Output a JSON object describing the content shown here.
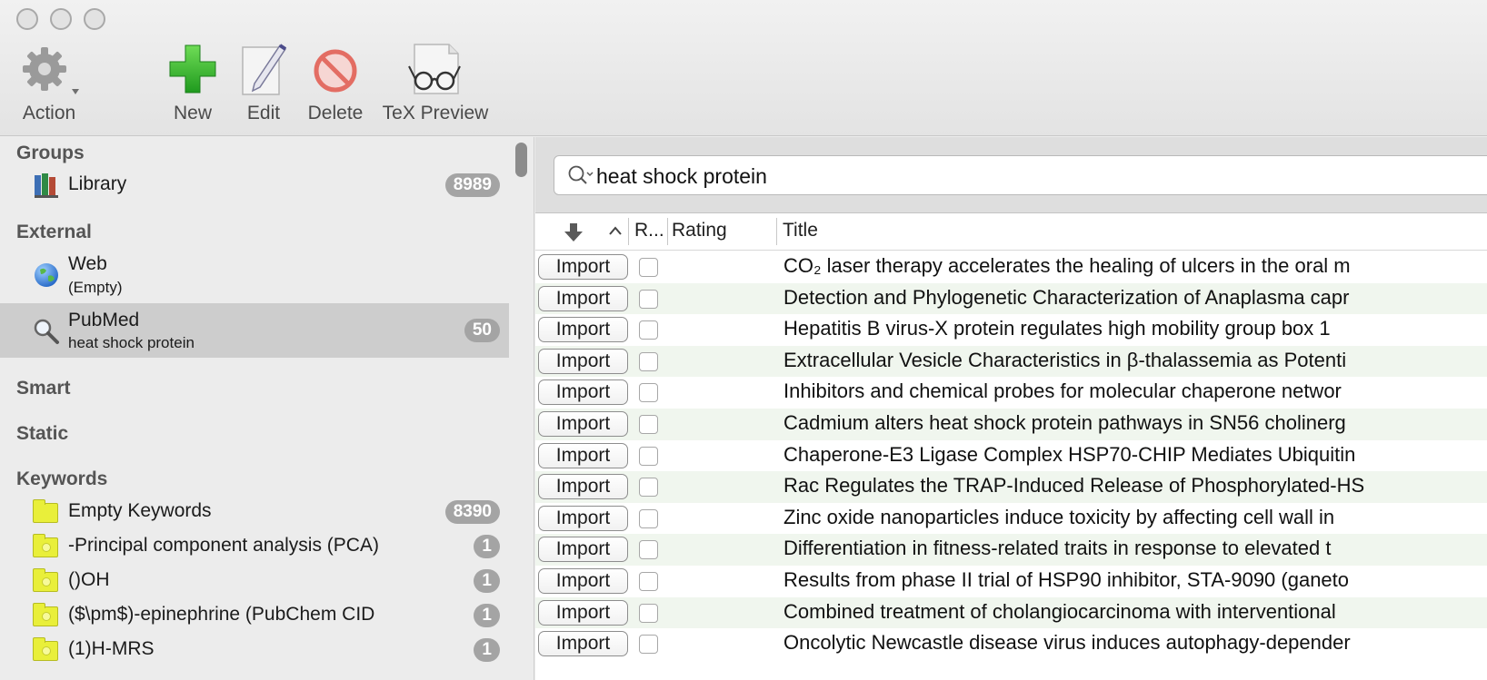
{
  "toolbar": {
    "action_label": "Action",
    "new_label": "New",
    "edit_label": "Edit",
    "delete_label": "Delete",
    "tex_preview_label": "TeX Preview"
  },
  "sidebar": {
    "groups_header": "Groups",
    "library": {
      "label": "Library",
      "count": "8989"
    },
    "external_header": "External",
    "web": {
      "label": "Web",
      "sub": "(Empty)"
    },
    "pubmed": {
      "label": "PubMed",
      "sub": "heat shock protein",
      "count": "50"
    },
    "smart_header": "Smart",
    "static_header": "Static",
    "keywords_header": "Keywords",
    "keywords": [
      {
        "label": "Empty Keywords",
        "count": "8390"
      },
      {
        "label": "-Principal component analysis (PCA)",
        "count": "1"
      },
      {
        "label": "()OH",
        "count": "1"
      },
      {
        "label": "($\\pm$)-epinephrine (PubChem CID",
        "count": "1"
      },
      {
        "label": "(1)H-MRS",
        "count": "1"
      }
    ]
  },
  "search": {
    "value": "heat shock protein"
  },
  "table": {
    "headers": {
      "read": "R...",
      "rating": "Rating",
      "title": "Title"
    },
    "import_label": "Import",
    "rows": [
      "CO₂ laser therapy accelerates the healing of ulcers in the oral m",
      "Detection and Phylogenetic Characterization of Anaplasma capr",
      "Hepatitis B virus-X protein regulates high mobility group box 1",
      "Extracellular Vesicle Characteristics in β-thalassemia as Potenti",
      "Inhibitors and chemical probes for molecular chaperone networ",
      "Cadmium alters heat shock protein pathways in SN56 cholinerg",
      "Chaperone-E3 Ligase Complex HSP70-CHIP Mediates Ubiquitin",
      "Rac Regulates the TRAP-Induced Release of Phosphorylated-HS",
      "Zinc oxide nanoparticles induce toxicity by affecting cell wall in",
      "Differentiation in fitness-related traits in response to elevated t",
      "Results from phase II trial of HSP90 inhibitor, STA-9090 (ganeto",
      "Combined treatment of cholangiocarcinoma with interventional",
      "Oncolytic Newcastle disease virus induces autophagy-depender"
    ]
  }
}
